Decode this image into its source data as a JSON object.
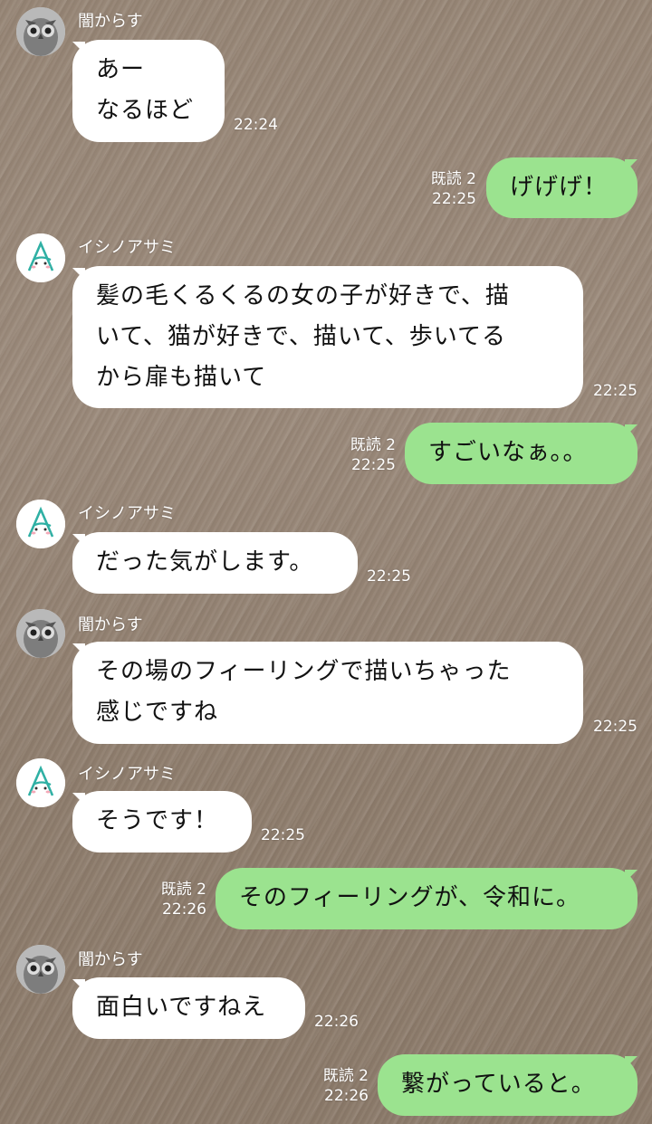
{
  "users": {
    "karasu": {
      "name": "闇からす",
      "avatar_icon": "owl-avatar-icon"
    },
    "ishino": {
      "name": "イシノアサミ",
      "avatar_icon": "letter-a-avatar-icon"
    }
  },
  "colors": {
    "outgoing_bubble": "#9be38f",
    "incoming_bubble": "#ffffff"
  },
  "messages": [
    {
      "sender": "闇からす",
      "text": "あー\nなるほど",
      "time": "22:24"
    },
    {
      "read": "既読 2",
      "text": "げげげ！",
      "time": "22:25"
    },
    {
      "sender": "イシノアサミ",
      "text": "髪の毛くるくるの女の子が好きで、描\nいて、猫が好きで、描いて、歩いてる\nから扉も描いて",
      "time": "22:25"
    },
    {
      "read": "既読 2",
      "text": "すごいなぁ。。",
      "time": "22:25"
    },
    {
      "sender": "イシノアサミ",
      "text": "だった気がします。",
      "time": "22:25"
    },
    {
      "sender": "闇からす",
      "text": "その場のフィーリングで描いちゃった\n感じですね",
      "time": "22:25"
    },
    {
      "sender": "イシノアサミ",
      "text": "そうです！",
      "time": "22:25"
    },
    {
      "read": "既読 2",
      "text": "そのフィーリングが、令和に。",
      "time": "22:26"
    },
    {
      "sender": "闇からす",
      "text": "面白いですねえ",
      "time": "22:26"
    },
    {
      "read": "既読 2",
      "text": "繋がっていると。",
      "time": "22:26"
    }
  ]
}
